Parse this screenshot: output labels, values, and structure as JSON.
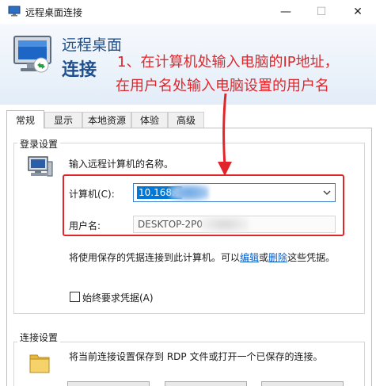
{
  "window": {
    "title": "远程桌面连接",
    "controls": {
      "minimize": "—",
      "maximize": "☐",
      "close": "✕"
    }
  },
  "banner": {
    "line1": "远程桌面",
    "line2": "连接"
  },
  "annotation": {
    "line1": "1、在计算机处输入电脑的IP地址，",
    "line2": "在用户名处输入电脑设置的用户名",
    "color": "#e1262b"
  },
  "tabs": [
    {
      "label": "常规",
      "active": true
    },
    {
      "label": "显示",
      "active": false
    },
    {
      "label": "本地资源",
      "active": false
    },
    {
      "label": "体验",
      "active": false
    },
    {
      "label": "高级",
      "active": false
    }
  ],
  "login_settings": {
    "title": "登录设置",
    "instruction": "输入远程计算机的名称。",
    "computer_label": "计算机(C):",
    "computer_value": "10.168.1",
    "username_label": "用户名:",
    "username_value": "DESKTOP-2P0",
    "saved_creds_prefix": "将使用保存的凭据连接到此计算机。可以",
    "edit_link": "编辑",
    "or_text": "或",
    "delete_link": "删除",
    "saved_creds_suffix": "这些凭据。",
    "always_ask_label": "始终要求凭据(A)"
  },
  "connection_settings": {
    "title": "连接设置",
    "description": "将当前连接设置保存到 RDP 文件或打开一个已保存的连接。"
  },
  "colors": {
    "accent": "#0078d7",
    "annotation_red": "#e1262b",
    "banner_text": "#1e4f8f",
    "link": "#0b5fc6"
  }
}
